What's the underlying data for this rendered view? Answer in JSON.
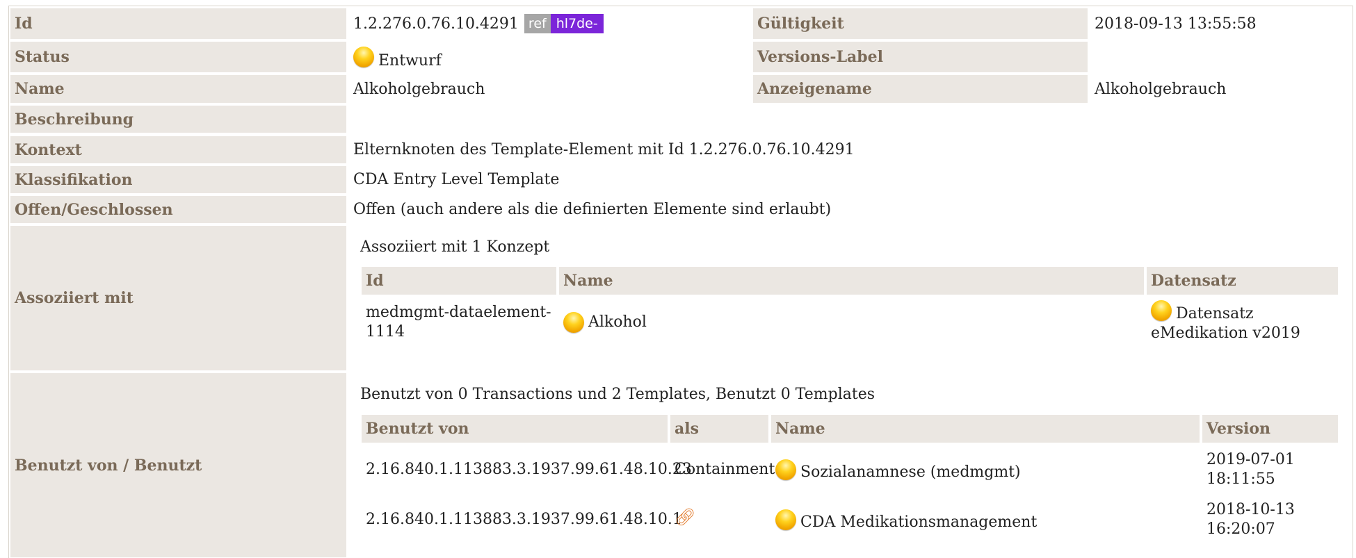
{
  "labels": {
    "id": "Id",
    "status": "Status",
    "name": "Name",
    "beschreibung": "Beschreibung",
    "kontext": "Kontext",
    "klassifikation": "Klassifikation",
    "offen": "Offen/Geschlossen",
    "assoziiert": "Assoziiert mit",
    "benutzt": "Benutzt von / Benutzt",
    "gueltigkeit": "Gültigkeit",
    "versions_label": "Versions-Label",
    "anzeigename": "Anzeigename"
  },
  "values": {
    "id": "1.2.276.0.76.10.4291",
    "ref_badge": "ref",
    "prefix_badge": "hl7de-",
    "status": "Entwurf",
    "name": "Alkoholgebrauch",
    "gueltigkeit": "2018-09-13 13:55:58",
    "versions_label": "",
    "anzeigename": "Alkoholgebrauch",
    "beschreibung": "",
    "kontext": "Elternknoten des Template-Element mit Id 1.2.276.0.76.10.4291",
    "klassifikation": "CDA Entry Level Template",
    "offen": "Offen (auch andere als die definierten Elemente sind erlaubt)"
  },
  "assoziiert": {
    "summary": "Assoziiert mit 1 Konzept",
    "headers": [
      "Id",
      "Name",
      "Datensatz"
    ],
    "rows": [
      {
        "id": "medmgmt-dataelement-1114",
        "name": "Alkohol",
        "datensatz": "Datensatz eMedikation v2019"
      }
    ]
  },
  "benutzt": {
    "summary": "Benutzt von 0 Transactions und 2 Templates, Benutzt 0 Templates",
    "headers": [
      "Benutzt von",
      "als",
      "Name",
      "Version"
    ],
    "rows": [
      {
        "oid": "2.16.840.1.113883.3.1937.99.61.48.10.23",
        "als": "Containment",
        "name": "Sozialanamnese (medmgmt)",
        "version": "2019-07-01 18:11:55"
      },
      {
        "oid": "2.16.840.1.113883.3.1937.99.61.48.10.1",
        "als": "link-icon",
        "name": "CDA Medikationsmanagement",
        "version": "2018-10-13 16:20:07"
      }
    ]
  },
  "colors": {
    "label_bg": "#ebe7e2",
    "label_text": "#7a6a58",
    "ref_badge": "#a6a6a6",
    "prefix_badge": "#7b25d9",
    "status_dot": "#f2a800",
    "link_icon": "#e2792a"
  }
}
